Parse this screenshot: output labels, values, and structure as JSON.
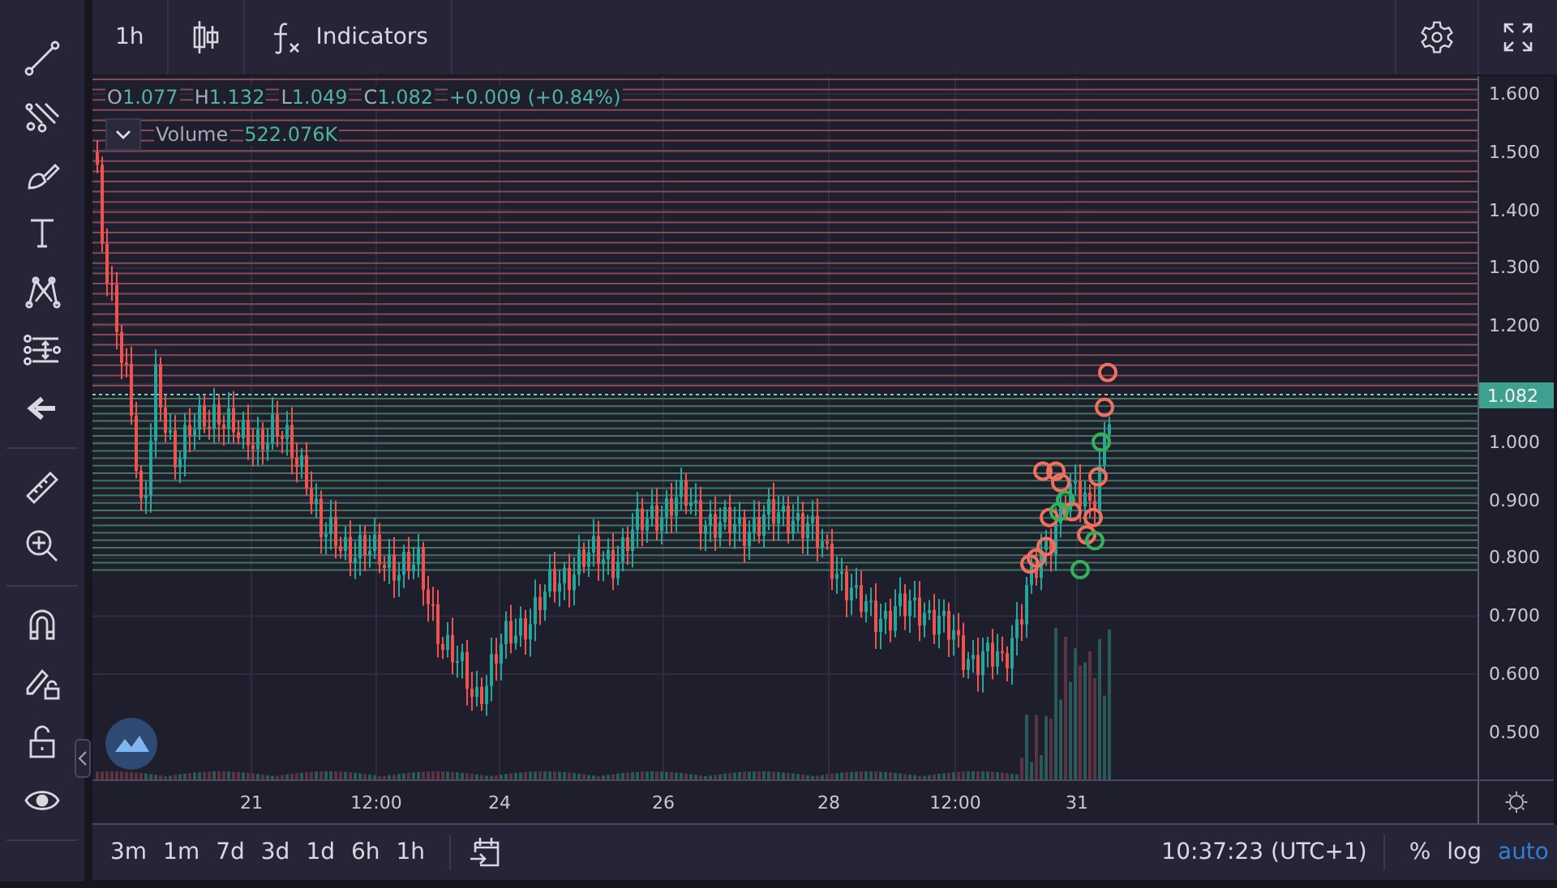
{
  "top_bar": {
    "interval": "1h",
    "indicators_label": "Indicators"
  },
  "legend": {
    "values": [
      {
        "label": "O",
        "value": "1.077"
      },
      {
        "label": "H",
        "value": "1.132"
      },
      {
        "label": "L",
        "value": "1.049"
      },
      {
        "label": "C",
        "value": "1.082"
      }
    ],
    "change": "+0.009 (+0.84%)",
    "volume_label": "Volume",
    "volume_value": "522.076K"
  },
  "price_axis": {
    "labels": [
      "1.600",
      "1.500",
      "1.400",
      "1.300",
      "1.200",
      "1.000",
      "0.900",
      "0.800",
      "0.700",
      "0.600",
      "0.500"
    ],
    "current_price": "1.082"
  },
  "time_axis": {
    "labels": [
      "21",
      "12:00",
      "24",
      "26",
      "28",
      "12:00",
      "31"
    ]
  },
  "range_buttons": [
    {
      "label": "3m"
    },
    {
      "label": "1m"
    },
    {
      "label": "7d"
    },
    {
      "label": "3d"
    },
    {
      "label": "1d"
    },
    {
      "label": "6h"
    },
    {
      "label": "1h"
    }
  ],
  "clock": "10:37:23 (UTC+1)",
  "scale_options": [
    {
      "label": "%",
      "selected": false
    },
    {
      "label": "log",
      "selected": false
    },
    {
      "label": "auto",
      "selected": true
    }
  ]
}
